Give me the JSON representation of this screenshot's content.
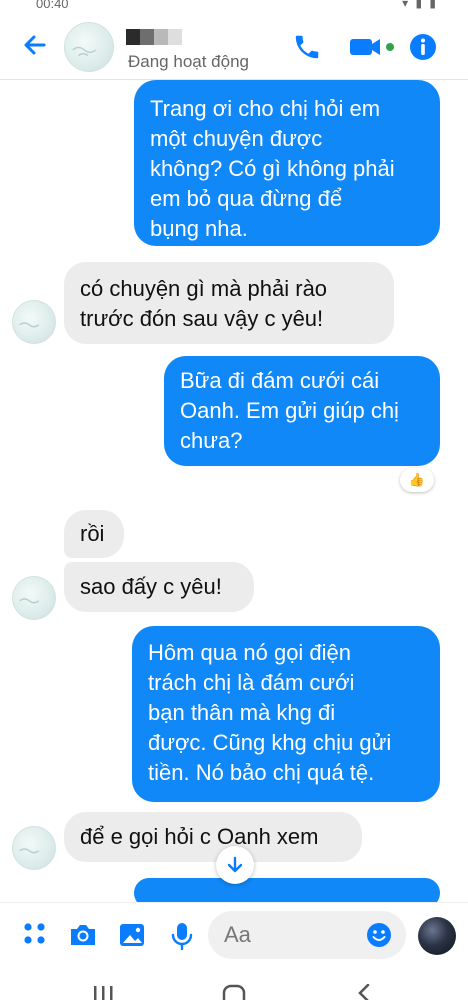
{
  "status_bar": {
    "time": "00:40"
  },
  "header": {
    "contact_name": "",
    "status": "Đang hoạt động",
    "icons": [
      "back-arrow-icon",
      "phone-icon",
      "video-call-icon",
      "info-icon"
    ],
    "accent_color": "#0a7cff"
  },
  "messages": [
    {
      "side": "out",
      "lines": [
        "Trang ơi cho chị hỏi em",
        "một chuyện được",
        "không? Có gì không phải",
        "em bỏ qua đừng để",
        "bụng nha."
      ]
    },
    {
      "side": "in",
      "lines": [
        "có chuyện gì mà phải rào",
        "trước đón sau vậy c yêu!"
      ]
    },
    {
      "side": "out",
      "lines": [
        "Bữa đi đám cưới cái",
        "Oanh. Em gửi giúp chị",
        "chưa?"
      ],
      "reaction": "thumbs-up"
    },
    {
      "side": "in",
      "lines": [
        "rồi"
      ]
    },
    {
      "side": "in",
      "lines": [
        "sao đấy c yêu!"
      ]
    },
    {
      "side": "out",
      "lines": [
        "Hôm qua nó gọi điện",
        "trách chị là đám cưới",
        "bạn thân mà khg đi",
        "được. Cũng khg chịu gửi",
        "tiền. Nó bảo chị quá tệ."
      ]
    },
    {
      "side": "in",
      "lines": [
        "để e gọi hỏi c Oanh xem"
      ]
    }
  ],
  "reaction": {
    "emoji": "👍"
  },
  "composer": {
    "placeholder": "Aa",
    "icons": [
      "menu-dots-icon",
      "camera-icon",
      "gallery-icon",
      "microphone-icon",
      "emoji-icon",
      "like-icon"
    ]
  },
  "bubble_colors": {
    "outgoing": "#1188f7",
    "incoming": "#ececec"
  }
}
